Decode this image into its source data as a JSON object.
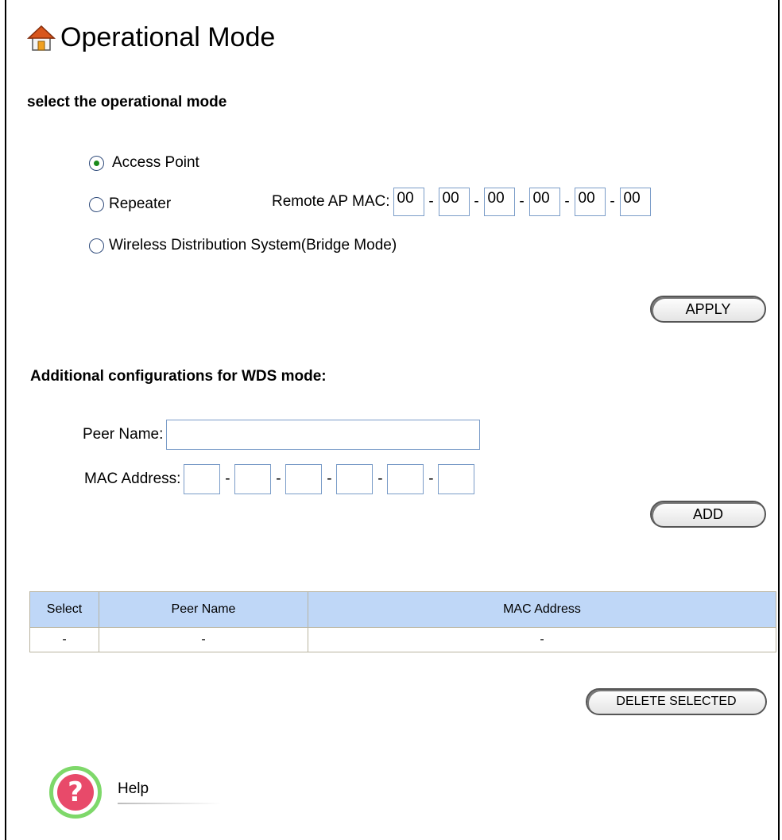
{
  "page": {
    "title": "Operational Mode",
    "title_icon": "home-icon"
  },
  "mode_section": {
    "heading": "select the operational mode",
    "options": [
      {
        "label": "Access Point",
        "selected": true
      },
      {
        "label": "Repeater",
        "selected": false
      },
      {
        "label": "Wireless Distribution System(Bridge Mode)",
        "selected": false
      }
    ],
    "remote_mac_label": "Remote AP MAC:",
    "remote_mac": [
      "00",
      "00",
      "00",
      "00",
      "00",
      "00"
    ],
    "mac_separator": "-",
    "apply_label": "APPLY"
  },
  "wds_section": {
    "heading": "Additional configurations for WDS mode:",
    "peer_name_label": "Peer Name:",
    "peer_name_value": "",
    "mac_label": "MAC Address:",
    "mac_values": [
      "",
      "",
      "",
      "",
      "",
      ""
    ],
    "mac_separator": "-",
    "add_label": "ADD"
  },
  "peer_table": {
    "headers": [
      "Select",
      "Peer Name",
      "MAC Address"
    ],
    "rows": [
      [
        "-",
        "-",
        "-"
      ]
    ]
  },
  "delete_label": "DELETE SELECTED",
  "help": {
    "label": "Help",
    "icon": "help-question-icon",
    "ring_color": "#7ed86a",
    "fill_color": "#e84a6a"
  },
  "colors": {
    "table_header": "#bfd7f7",
    "input_border": "#7a9cc8"
  }
}
